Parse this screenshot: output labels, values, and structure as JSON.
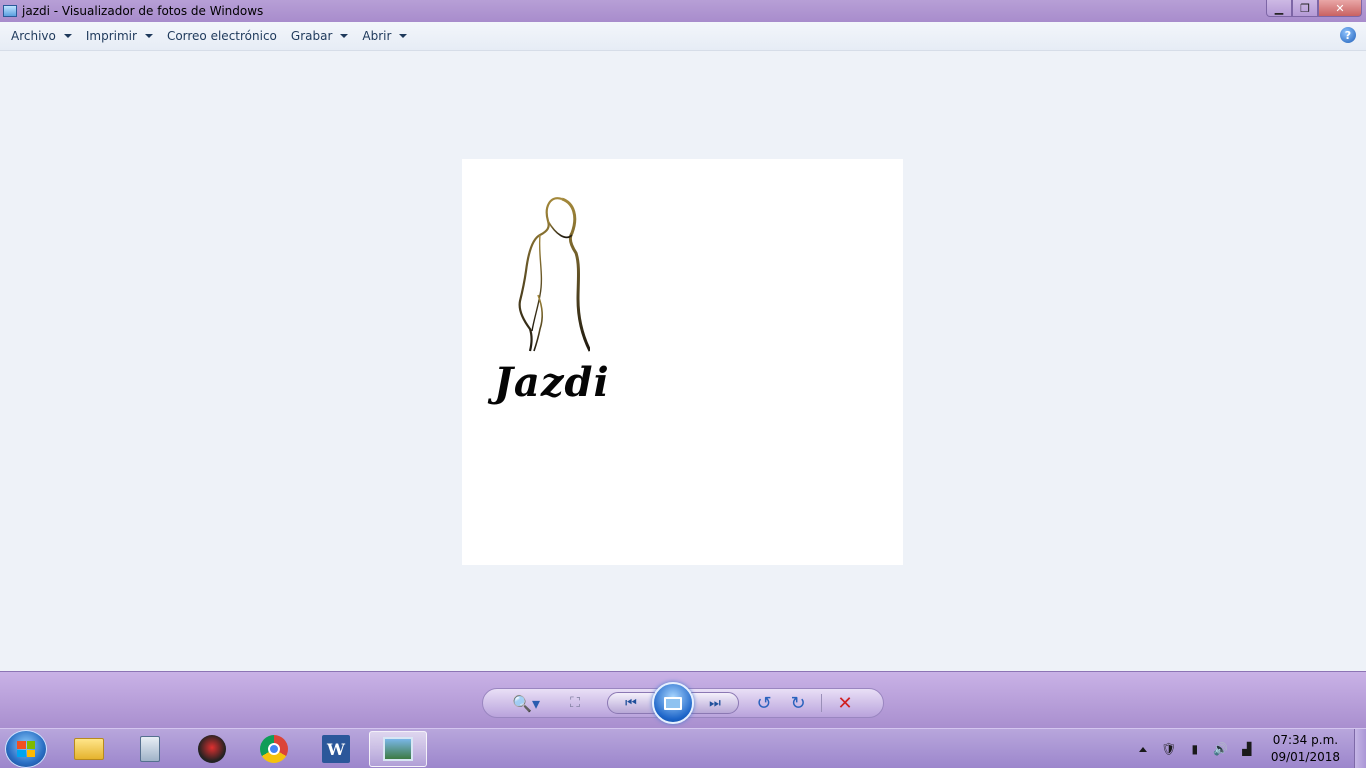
{
  "window": {
    "title": "jazdi - Visualizador de fotos de Windows",
    "controls": {
      "minimize_icon": "minimize-icon",
      "maximize_icon": "restore-icon",
      "close_icon": "close-icon"
    }
  },
  "menu": {
    "items": [
      {
        "label": "Archivo",
        "has_dropdown": true
      },
      {
        "label": "Imprimir",
        "has_dropdown": true
      },
      {
        "label": "Correo electrónico",
        "has_dropdown": false
      },
      {
        "label": "Grabar",
        "has_dropdown": true
      },
      {
        "label": "Abrir",
        "has_dropdown": true
      }
    ],
    "help_label": "?"
  },
  "photo": {
    "brand_text": "Jazdi",
    "figure_colors": {
      "top": "#a3883a",
      "bottom": "#1f1a10"
    }
  },
  "controls": {
    "zoom_icon": "zoom-icon",
    "fit_icon": "actual-size-icon",
    "prev_icon": "previous-icon",
    "slideshow_icon": "slideshow-icon",
    "next_icon": "next-icon",
    "rotate_left_icon": "rotate-counterclockwise-icon",
    "rotate_right_icon": "rotate-clockwise-icon",
    "delete_icon": "delete-icon",
    "glyphs": {
      "zoom": "🔍▾",
      "fit": "⛶",
      "prev": "⏮",
      "next": "⏭",
      "rotate_left": "↺",
      "rotate_right": "↻",
      "delete": "✕"
    }
  },
  "taskbar": {
    "apps": [
      {
        "name": "file-explorer",
        "active": false
      },
      {
        "name": "calculator",
        "active": false
      },
      {
        "name": "red-app",
        "active": false
      },
      {
        "name": "chrome",
        "active": false
      },
      {
        "name": "word",
        "active": false,
        "glyph": "W"
      },
      {
        "name": "photo-viewer",
        "active": true
      }
    ],
    "tray": {
      "time": "07:34 p.m.",
      "date": "09/01/2018"
    }
  }
}
